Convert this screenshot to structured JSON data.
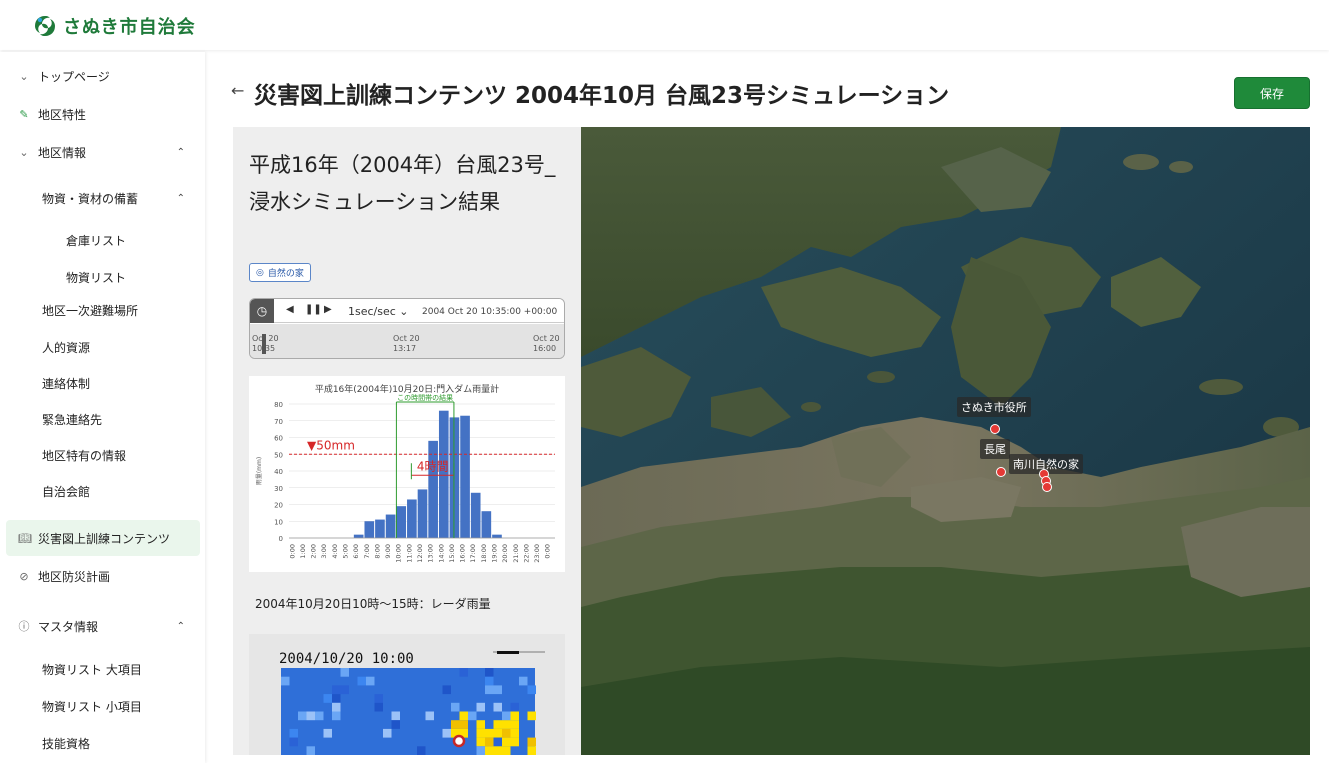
{
  "header": {
    "app_name": "さぬき市自治会"
  },
  "sidebar": {
    "items": [
      {
        "label": "トップページ",
        "icon": "chevron-down-icon"
      },
      {
        "label": "地区特性",
        "icon": "edit-icon"
      },
      {
        "label": "地区情報",
        "icon": "chevron-down-icon",
        "caret": "⌃"
      },
      {
        "label": "物資・資材の備蓄",
        "caret": "⌃"
      },
      {
        "label": "倉庫リスト"
      },
      {
        "label": "物資リスト"
      },
      {
        "label": "地区一次避難場所"
      },
      {
        "label": "人的資源"
      },
      {
        "label": "連絡体制"
      },
      {
        "label": "緊急連絡先"
      },
      {
        "label": "地区特有の情報"
      },
      {
        "label": "自治会館"
      },
      {
        "label": "災害図上訓練コンテンツ",
        "icon": "book-icon",
        "active": true
      },
      {
        "label": "地区防災計画",
        "icon": "check-circle-icon"
      },
      {
        "label": "マスタ情報",
        "icon": "info-icon",
        "caret": "⌃"
      },
      {
        "label": "物資リスト 大項目"
      },
      {
        "label": "物資リスト 小項目"
      },
      {
        "label": "技能資格"
      }
    ]
  },
  "page": {
    "back_icon": "←",
    "title": "災害図上訓練コンテンツ 2004年10月 台風23号シミュレーション",
    "save_label": "保存"
  },
  "panel": {
    "title": "平成16年（2004年）台風23号_浸水シミュレーション結果",
    "tag_label": "自然の家",
    "timeline": {
      "speed": "1sec/sec",
      "current": "2004 Oct 20 10:35:00 +00:00",
      "ticks": [
        {
          "line1": "Oct 20",
          "line2": "10:35"
        },
        {
          "line1": "Oct 20",
          "line2": "13:17"
        },
        {
          "line1": "Oct 20",
          "line2": "16:00"
        }
      ]
    },
    "caption": "2004年10月20日10時～15時：レーダ雨量",
    "radar_time": "2004/10/20 10:00"
  },
  "chart_data": {
    "type": "bar",
    "title": "平成16年(2004年)10月20日:門入ダム雨量計",
    "ylabel": "雨量(mm)",
    "ylim": [
      0,
      80
    ],
    "yticks": [
      0,
      10,
      20,
      30,
      40,
      50,
      60,
      70,
      80
    ],
    "categories": [
      "0:00",
      "1:00",
      "2:00",
      "3:00",
      "4:00",
      "5:00",
      "6:00",
      "7:00",
      "8:00",
      "9:00",
      "10:00",
      "11:00",
      "12:00",
      "13:00",
      "14:00",
      "15:00",
      "16:00",
      "17:00",
      "18:00",
      "19:00",
      "20:00",
      "21:00",
      "22:00",
      "23:00",
      "0:00"
    ],
    "values": [
      0,
      0,
      0,
      0,
      0,
      0,
      2,
      10,
      11,
      14,
      19,
      23,
      29,
      58,
      76,
      72,
      73,
      27,
      16,
      2,
      0,
      0,
      0,
      0,
      0
    ],
    "threshold_label": "▼50mm",
    "threshold_value": 50,
    "bracket_label": "この時間帯の結果",
    "span_label": "4時間",
    "colors": {
      "bar": "#4472c4",
      "threshold": "#d62728",
      "bracket": "#2e9b2e"
    }
  },
  "map": {
    "labels": [
      "さぬき市役所",
      "長尾",
      "南川自然の家"
    ],
    "pin_color": "#e53935"
  }
}
